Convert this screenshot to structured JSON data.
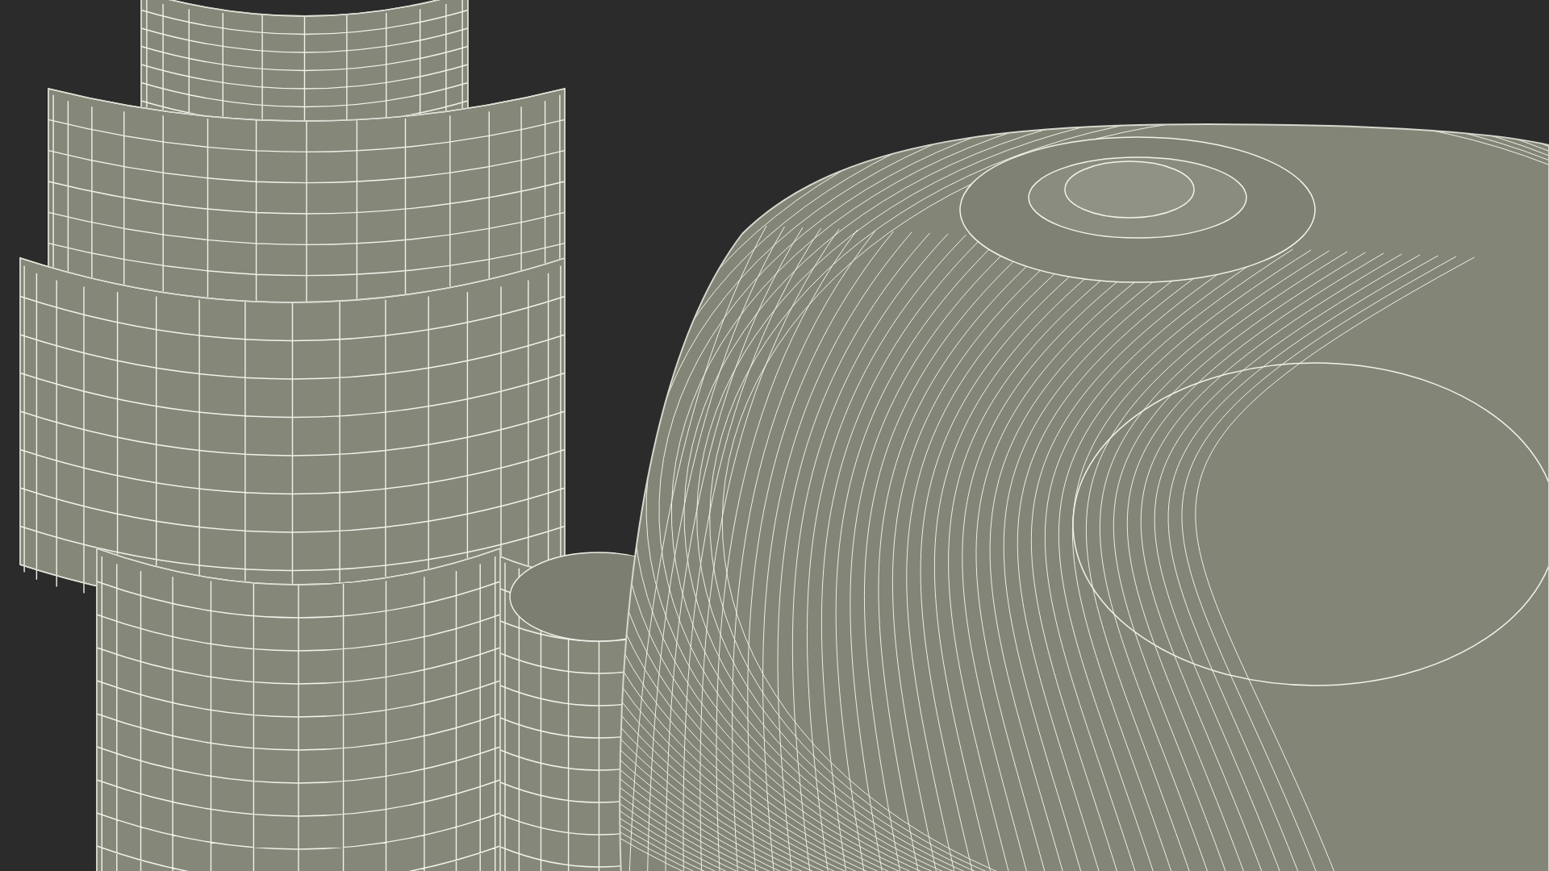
{
  "scene": {
    "kind": "wireframe-render"
  }
}
